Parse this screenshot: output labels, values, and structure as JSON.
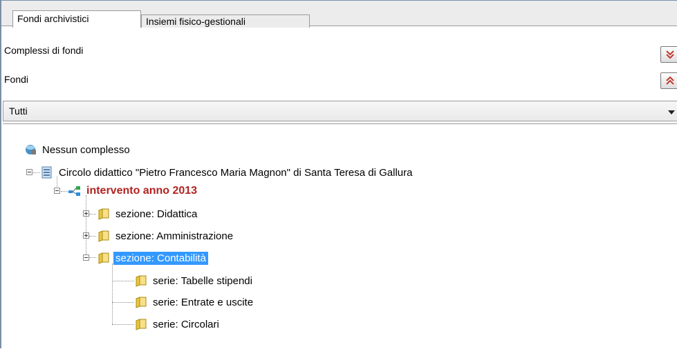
{
  "tabs": [
    {
      "label": "Fondi archivistici",
      "active": true
    },
    {
      "label": "Insiemi fisico-gestionali",
      "active": false
    }
  ],
  "rows": {
    "complessi_label": "Complessi di fondi",
    "fondi_label": "Fondi"
  },
  "filter": {
    "selected": "Tutti"
  },
  "tree": {
    "root": {
      "label": "Nessun complesso",
      "icon": "database-icon"
    },
    "fondo": {
      "label": "Circolo didattico \"Pietro Francesco Maria Magnon\" di Santa Teresa di Gallura",
      "icon": "archive-icon"
    },
    "intervento": {
      "label": "intervento anno 2013",
      "icon": "network-icon"
    },
    "sezioni": [
      {
        "label": "sezione: Didattica",
        "icon": "folder-icon",
        "expanded": false
      },
      {
        "label": "sezione: Amministrazione",
        "icon": "folder-icon",
        "expanded": false
      },
      {
        "label": "sezione: Contabilità",
        "icon": "folder-icon",
        "expanded": true,
        "selected": true
      }
    ],
    "serie": [
      {
        "label": "serie: Tabelle stipendi",
        "icon": "folder-icon"
      },
      {
        "label": "serie: Entrate e uscite",
        "icon": "folder-icon"
      },
      {
        "label": "serie: Circolari",
        "icon": "folder-icon"
      }
    ]
  },
  "colors": {
    "selection": "#3399ff",
    "intervento_text": "#b22222",
    "button_arrow": "#c0392b"
  }
}
